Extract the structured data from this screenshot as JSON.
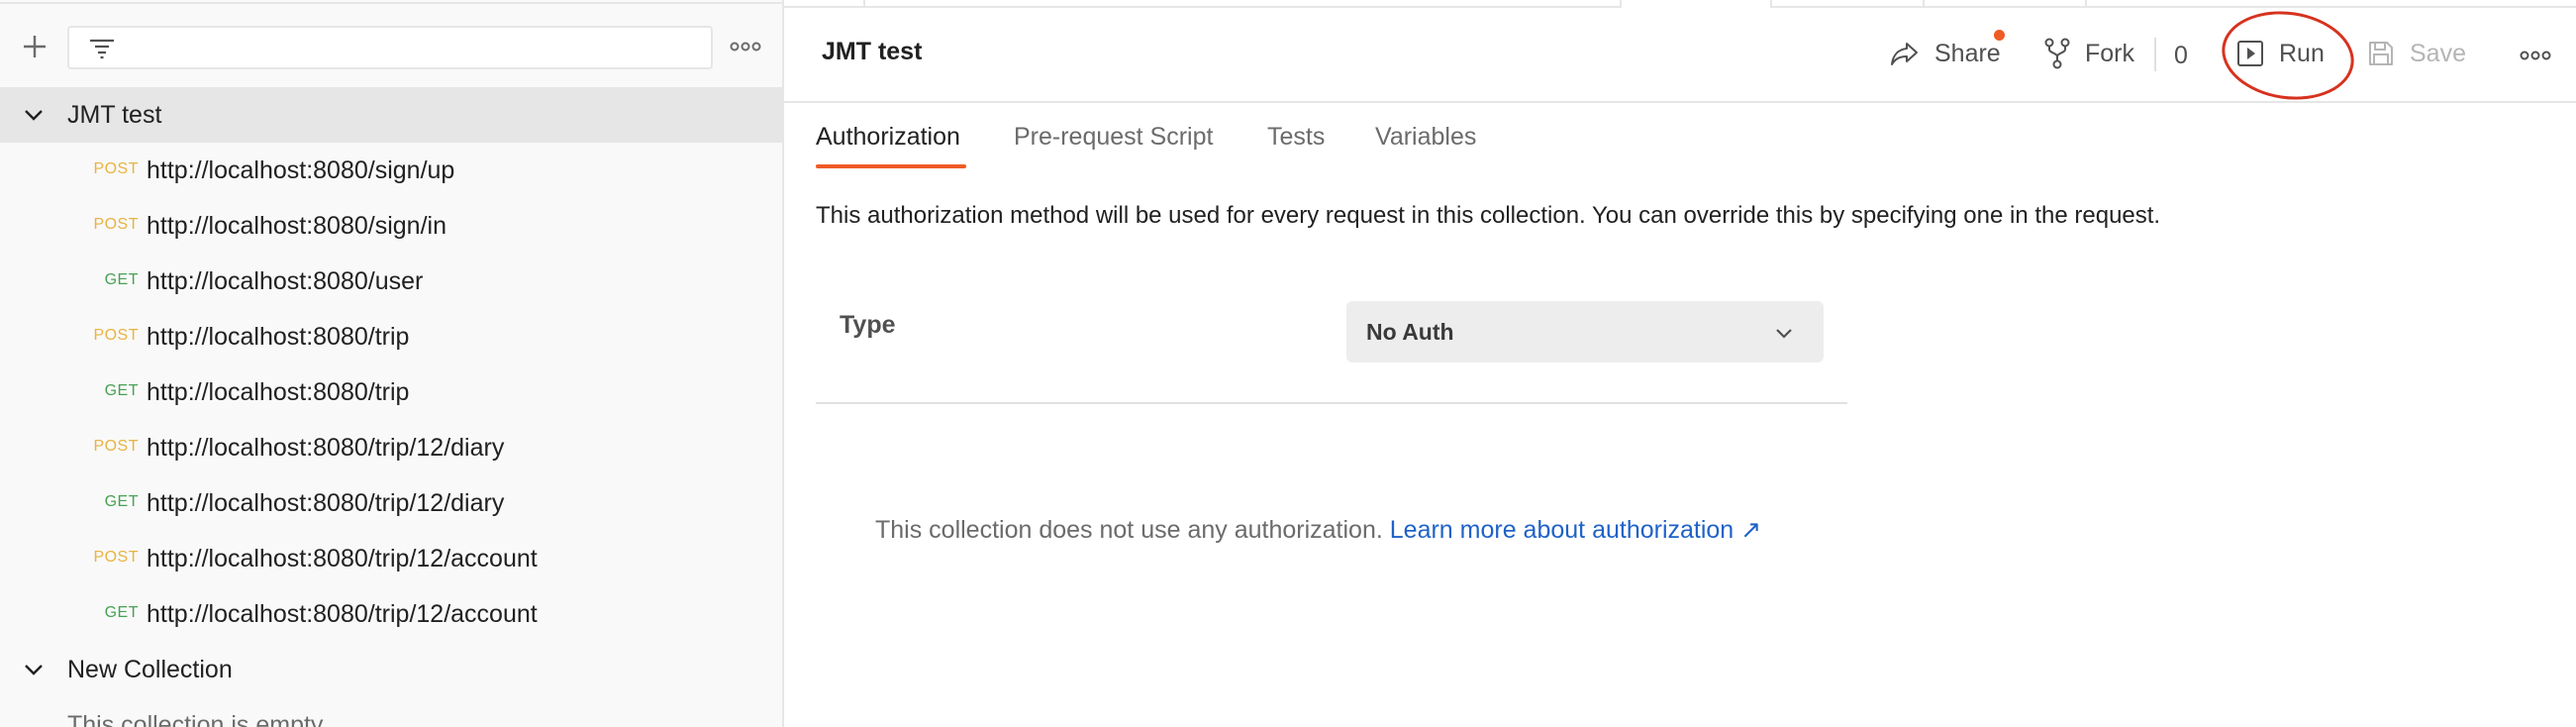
{
  "sidebar": {
    "collections": [
      {
        "name": "JMT test",
        "expanded": true,
        "requests": [
          {
            "method": "POST",
            "url": "http://localhost:8080/sign/up"
          },
          {
            "method": "POST",
            "url": "http://localhost:8080/sign/in"
          },
          {
            "method": "GET",
            "url": "http://localhost:8080/user"
          },
          {
            "method": "POST",
            "url": "http://localhost:8080/trip"
          },
          {
            "method": "GET",
            "url": "http://localhost:8080/trip"
          },
          {
            "method": "POST",
            "url": "http://localhost:8080/trip/12/diary"
          },
          {
            "method": "GET",
            "url": "http://localhost:8080/trip/12/diary"
          },
          {
            "method": "POST",
            "url": "http://localhost:8080/trip/12/account"
          },
          {
            "method": "GET",
            "url": "http://localhost:8080/trip/12/account"
          }
        ]
      },
      {
        "name": "New Collection",
        "expanded": true,
        "empty_note": "This collection is empty"
      }
    ],
    "icons": {
      "new": "plus-icon",
      "filter": "filter-icon",
      "more": "more-icon"
    }
  },
  "header": {
    "title": "JMT test",
    "share_label": "Share",
    "fork_label": "Fork",
    "fork_count": "0",
    "run_label": "Run",
    "save_label": "Save"
  },
  "tabs": [
    {
      "label": "Authorization",
      "active": true
    },
    {
      "label": "Pre-request Script",
      "active": false
    },
    {
      "label": "Tests",
      "active": false
    },
    {
      "label": "Variables",
      "active": false
    }
  ],
  "auth": {
    "description": "This authorization method will be used for every request in this collection. You can override this by specifying one in the request.",
    "type_label": "Type",
    "type_value": "No Auth",
    "no_auth_text": "This collection does not use any authorization.",
    "learn_more": "Learn more about authorization ↗"
  },
  "colors": {
    "accent": "#ef5b25",
    "post": "#e8b341",
    "get": "#48a154",
    "link": "#1f62c8",
    "annotation": "#d7321f"
  }
}
